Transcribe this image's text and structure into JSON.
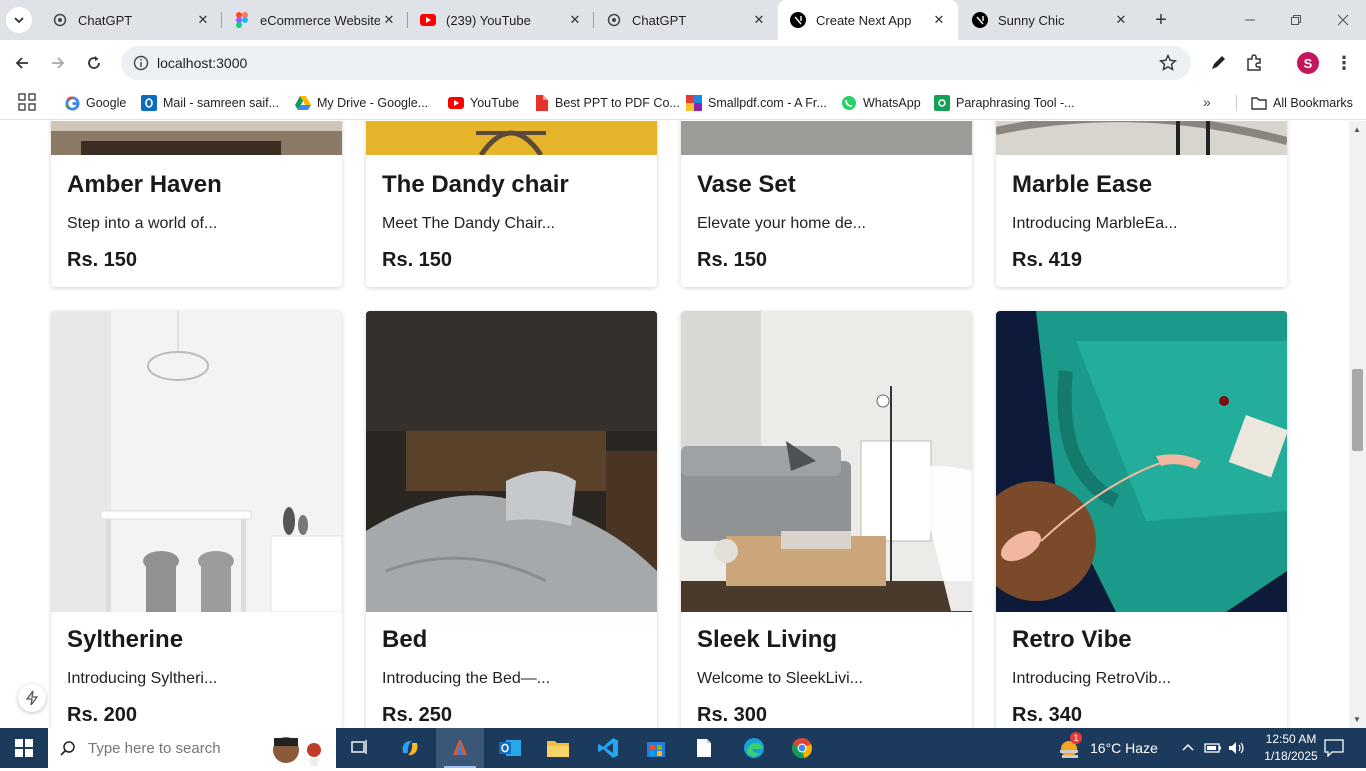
{
  "browser": {
    "tabs": [
      {
        "title": "ChatGPT",
        "icon": "chatgpt-icon"
      },
      {
        "title": "eCommerce Website",
        "icon": "figma-icon"
      },
      {
        "title": "(239) YouTube",
        "icon": "youtube-icon"
      },
      {
        "title": "ChatGPT",
        "icon": "chatgpt-icon"
      },
      {
        "title": "Create Next App",
        "icon": "nextjs-icon",
        "active": true
      },
      {
        "title": "Sunny Chic",
        "icon": "nextjs-icon"
      }
    ],
    "url": "localhost:3000",
    "profile_initial": "S",
    "bookmarks": [
      {
        "label": "Google",
        "icon": "google-icon"
      },
      {
        "label": "Mail - samreen saif...",
        "icon": "outlook-icon"
      },
      {
        "label": "My Drive - Google...",
        "icon": "drive-icon"
      },
      {
        "label": "YouTube",
        "icon": "youtube-icon"
      },
      {
        "label": "Best PPT to PDF Co...",
        "icon": "ilovepdf-icon"
      },
      {
        "label": "Smallpdf.com - A Fr...",
        "icon": "smallpdf-icon"
      },
      {
        "label": "WhatsApp",
        "icon": "whatsapp-icon"
      },
      {
        "label": "Paraphrasing Tool -...",
        "icon": "quillbot-icon"
      }
    ],
    "all_bookmarks": "All Bookmarks"
  },
  "products": [
    {
      "name": "Amber Haven",
      "desc": "Step into a world of...",
      "price": "Rs. 150"
    },
    {
      "name": "The Dandy chair",
      "desc": "Meet The Dandy Chair...",
      "price": "Rs. 150"
    },
    {
      "name": "Vase Set",
      "desc": "Elevate your home de...",
      "price": "Rs. 150"
    },
    {
      "name": "Marble Ease",
      "desc": "Introducing MarbleEa...",
      "price": "Rs. 419"
    },
    {
      "name": "Syltherine",
      "desc": "Introducing Syltheri...",
      "price": "Rs. 200"
    },
    {
      "name": "Bed",
      "desc": "Introducing the Bed—...",
      "price": "Rs. 250"
    },
    {
      "name": "Sleek Living",
      "desc": "Welcome to SleekLivi...",
      "price": "Rs. 300"
    },
    {
      "name": "Retro Vibe",
      "desc": "Introducing RetroVib...",
      "price": "Rs. 340"
    }
  ],
  "taskbar": {
    "search_placeholder": "Type here to search",
    "weather": "16°C  Haze",
    "weather_badge": "1",
    "time": "12:50 AM",
    "date": "1/18/2025"
  }
}
